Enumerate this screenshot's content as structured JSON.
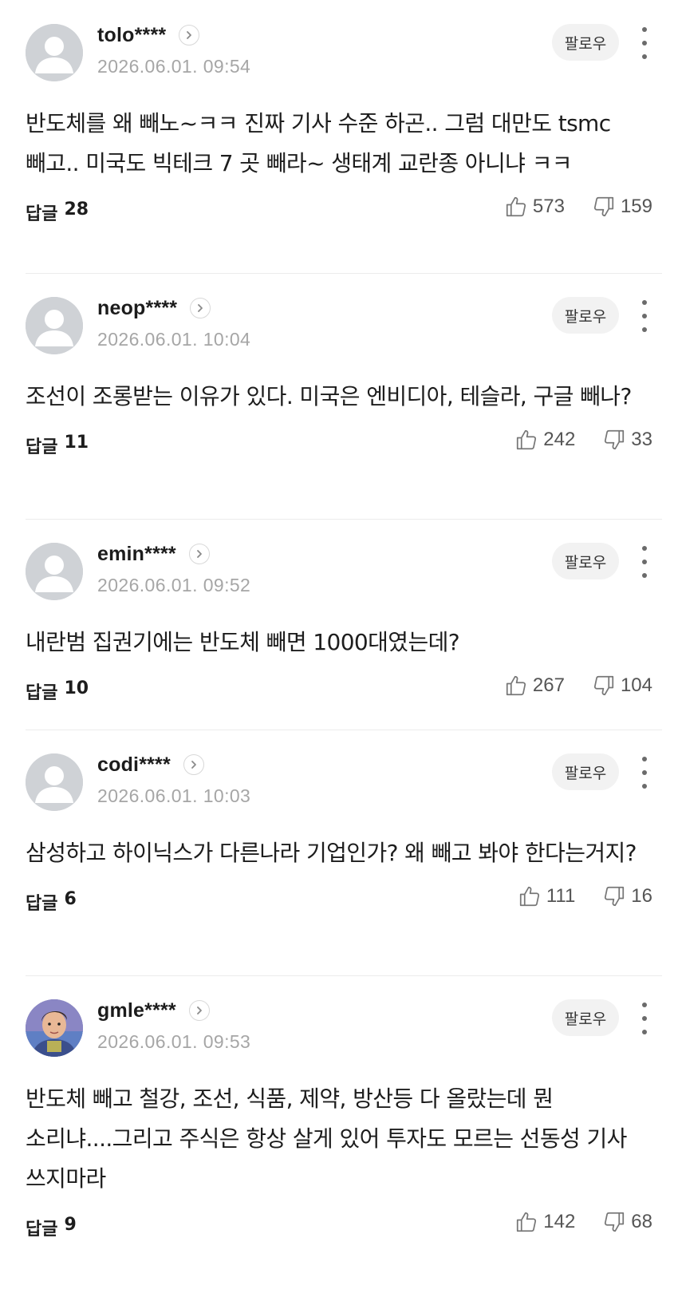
{
  "comments": [
    {
      "nickname": "tolo****",
      "date": "2026.06.01. 09:54",
      "follow_label": "팔로우",
      "text": "반도체를 왜 빼노~ㅋㅋ 진짜 기사 수준 하곤.. 그럼 대만도 tsmc 빼고.. 미국도 빅테크 7 곳 빼라~ 생태계 교란종 아니냐 ㅋㅋ",
      "reply_label": "답글",
      "reply_count": "28",
      "likes": "573",
      "dislikes": "159",
      "avatar": "default-avatar"
    },
    {
      "nickname": "neop****",
      "date": "2026.06.01. 10:04",
      "follow_label": "팔로우",
      "text": "조선이 조롱받는 이유가 있다. 미국은 엔비디아, 테슬라, 구글 빼나?",
      "reply_label": "답글",
      "reply_count": "11",
      "likes": "242",
      "dislikes": "33",
      "avatar": "default-avatar"
    },
    {
      "nickname": "emin****",
      "date": "2026.06.01. 09:52",
      "follow_label": "팔로우",
      "text": "내란범 집권기에는 반도체 빼면 1000대였는데?",
      "reply_label": "답글",
      "reply_count": "10",
      "likes": "267",
      "dislikes": "104",
      "avatar": "default-avatar"
    },
    {
      "nickname": "codi****",
      "date": "2026.06.01. 10:03",
      "follow_label": "팔로우",
      "text": "삼성하고 하이닉스가 다른나라 기업인가? 왜 빼고 봐야 한다는거지?",
      "reply_label": "답글",
      "reply_count": "6",
      "likes": "111",
      "dislikes": "16",
      "avatar": "default-avatar"
    },
    {
      "nickname": "gmle****",
      "date": "2026.06.01. 09:53",
      "follow_label": "팔로우",
      "text": "반도체 빼고 철강, 조선, 식품, 제약, 방산등 다 올랐는데 뭔 소리냐....그리고 주식은 항상 살게 있어 투자도 모르는 선동성 기사 쓰지마라",
      "reply_label": "답글",
      "reply_count": "9",
      "likes": "142",
      "dislikes": "68",
      "avatar": "profile-photo-avatar"
    }
  ],
  "icons": {
    "chevron": "chevron-right-icon",
    "more": "more-vertical-icon",
    "like": "thumbs-up-icon",
    "dislike": "thumbs-down-icon"
  },
  "colors": {
    "nickname": "#1c1c1c",
    "date": "#a6a6a6",
    "follow_bg": "#f2f2f2",
    "divider": "#ebebeb"
  }
}
